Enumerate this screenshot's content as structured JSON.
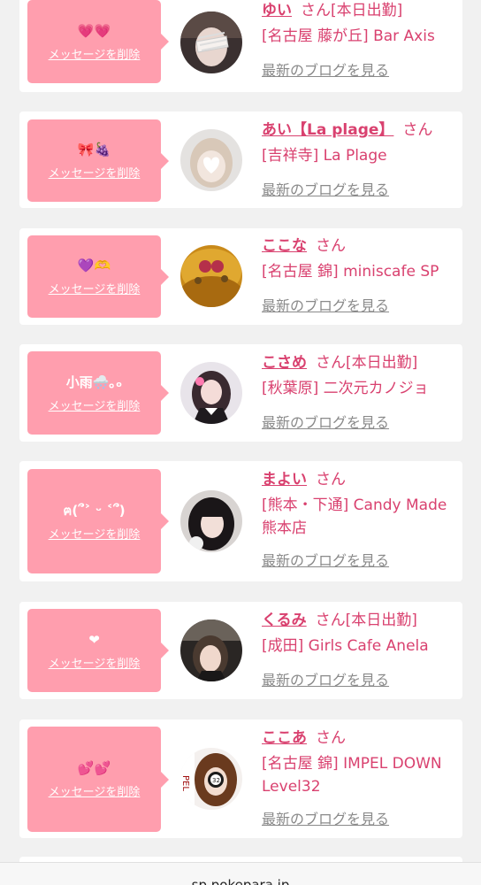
{
  "cards": [
    {
      "message": "💗💗",
      "delete_label": "メッセージを削除",
      "name": "ゆい",
      "san": "さん",
      "status": "[本日出勤]",
      "shop": "[名古屋 藤が丘] Bar Axis",
      "blog_label": "最新のブログを見る",
      "avatar_icon": "avatar-photo"
    },
    {
      "message": "🎀🍇",
      "delete_label": "メッセージを削除",
      "name": "あい【La plage】",
      "san": "さん",
      "status": "",
      "shop": "[吉祥寺] La Plage",
      "blog_label": "最新のブログを見る",
      "avatar_icon": "avatar-photo"
    },
    {
      "message": "💜🫶",
      "delete_label": "メッセージを削除",
      "name": "ここな",
      "san": "さん",
      "status": "",
      "shop": "[名古屋 錦] miniscafe SP",
      "blog_label": "最新のブログを見る",
      "avatar_icon": "avatar-photo"
    },
    {
      "message": "小雨🌨️｡ₒ",
      "delete_label": "メッセージを削除",
      "name": "こさめ",
      "san": "さん",
      "status": "[本日出勤]",
      "shop": "[秋葉原] 二次元カノジョ",
      "blog_label": "最新のブログを見る",
      "avatar_icon": "avatar-photo"
    },
    {
      "message": "ฅ(՞˃ ᵕ ˂՞)",
      "delete_label": "メッセージを削除",
      "name": "まよい",
      "san": "さん",
      "status": "",
      "shop": "[熊本・下通] Candy Made 熊本店",
      "blog_label": "最新のブログを見る",
      "avatar_icon": "avatar-photo"
    },
    {
      "message": "❤︎",
      "delete_label": "メッセージを削除",
      "name": "くるみ",
      "san": "さん",
      "status": "[本日出勤]",
      "shop": "[成田] Girls Cafe Anela",
      "blog_label": "最新のブログを見る",
      "avatar_icon": "avatar-photo"
    },
    {
      "message": "💕💕",
      "delete_label": "メッセージを削除",
      "name": "ここあ",
      "san": "さん",
      "status": "",
      "shop": "[名古屋 錦] IMPEL DOWN Level32",
      "blog_label": "最新のブログを見る",
      "avatar_icon": "avatar-photo"
    }
  ],
  "footer": {
    "domain": "sp.pokepara.jp"
  }
}
